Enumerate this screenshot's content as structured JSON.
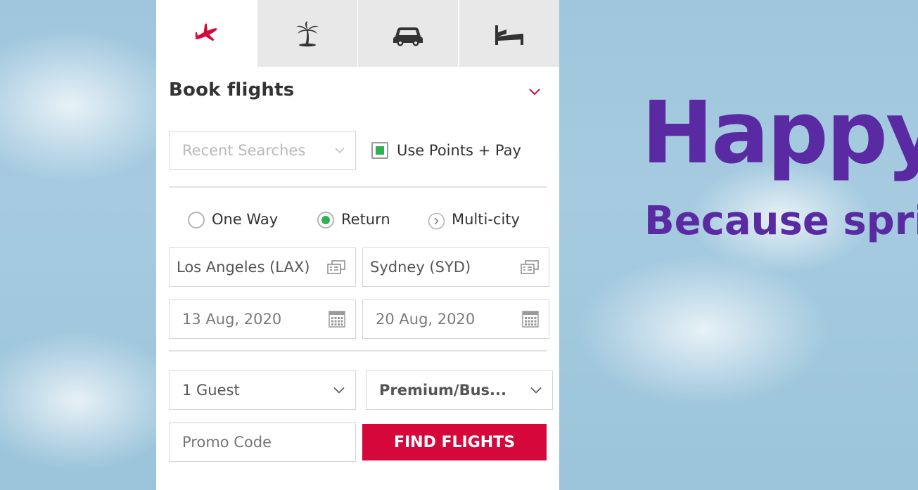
{
  "tabs": [
    {
      "icon": "plane-icon",
      "active": true
    },
    {
      "icon": "palm-tree-icon",
      "active": false
    },
    {
      "icon": "car-icon",
      "active": false
    },
    {
      "icon": "bed-icon",
      "active": false
    }
  ],
  "booking": {
    "title": "Book flights",
    "recent_searches_placeholder": "Recent Searches",
    "use_points_label": "Use Points + Pay",
    "trip_types": {
      "one_way": "One Way",
      "return": "Return",
      "multi_city": "Multi-city",
      "selected": "Return"
    },
    "origin": "Los Angeles (LAX)",
    "destination": "Sydney (SYD)",
    "depart_date": "13 Aug, 2020",
    "return_date": "20 Aug, 2020",
    "guests": "1 Guest",
    "cabin_class": "Premium/Bus...",
    "promo_placeholder": "Promo Code",
    "find_button": "FIND FLIGHTS"
  },
  "hero": {
    "headline": "Happy",
    "subhead": "Because spri"
  },
  "colors": {
    "accent_red": "#d6083b",
    "check_green": "#2eb24f",
    "hero_purple": "#5a2aa3"
  }
}
